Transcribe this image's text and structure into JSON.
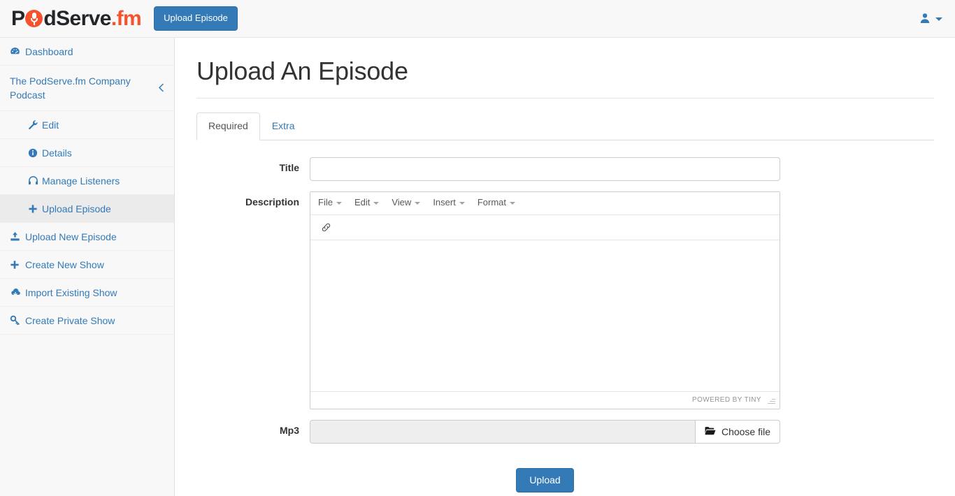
{
  "brand": {
    "text_pre": "P",
    "text_mid": "dServe",
    "text_suffix": ".fm",
    "icon": "microphone-icon"
  },
  "topbar": {
    "upload_episode_label": "Upload Episode",
    "user_icon": "user-icon",
    "caret_icon": "chevron-down-icon"
  },
  "colors": {
    "brand_orange": "#f4532e",
    "primary_blue": "#337ab7",
    "link_blue": "#337ab7",
    "navbar_bg": "#f8f8f8",
    "sidebar_bg": "#f8f8f8",
    "active_item_bg": "#ebebeb"
  },
  "sidebar": {
    "dashboard": {
      "label": "Dashboard",
      "icon": "tachometer-icon"
    },
    "show_group": {
      "label": "The PodServe.fm Company Podcast",
      "collapse_icon": "chevron-left-icon"
    },
    "show_items": [
      {
        "label": "Edit",
        "icon": "wrench-icon",
        "active": false
      },
      {
        "label": "Details",
        "icon": "info-circle-icon",
        "active": false
      },
      {
        "label": "Manage Listeners",
        "icon": "headphones-icon",
        "active": false
      },
      {
        "label": "Upload Episode",
        "icon": "plus-icon",
        "active": true
      }
    ],
    "global_items": [
      {
        "label": "Upload New Episode",
        "icon": "upload-icon"
      },
      {
        "label": "Create New Show",
        "icon": "plus-icon"
      },
      {
        "label": "Import Existing Show",
        "icon": "cloud-download-icon"
      },
      {
        "label": "Create Private Show",
        "icon": "key-icon"
      }
    ]
  },
  "main": {
    "page_title": "Upload An Episode",
    "tabs": [
      {
        "label": "Required",
        "active": true
      },
      {
        "label": "Extra",
        "active": false
      }
    ],
    "form": {
      "title_field": {
        "label": "Title",
        "value": "",
        "placeholder": ""
      },
      "description_field": {
        "label": "Description",
        "value": "",
        "editor": {
          "menu": [
            "File",
            "Edit",
            "View",
            "Insert",
            "Format"
          ],
          "toolbar_buttons": [
            {
              "name": "link-icon",
              "title": "Insert/edit link"
            }
          ],
          "branding": "POWERED BY TINY",
          "resize_handle": "resize-grip-icon"
        }
      },
      "mp3_field": {
        "label": "Mp3",
        "value": "",
        "button_label": "Choose file",
        "button_icon": "folder-open-icon"
      },
      "submit_label": "Upload"
    }
  }
}
